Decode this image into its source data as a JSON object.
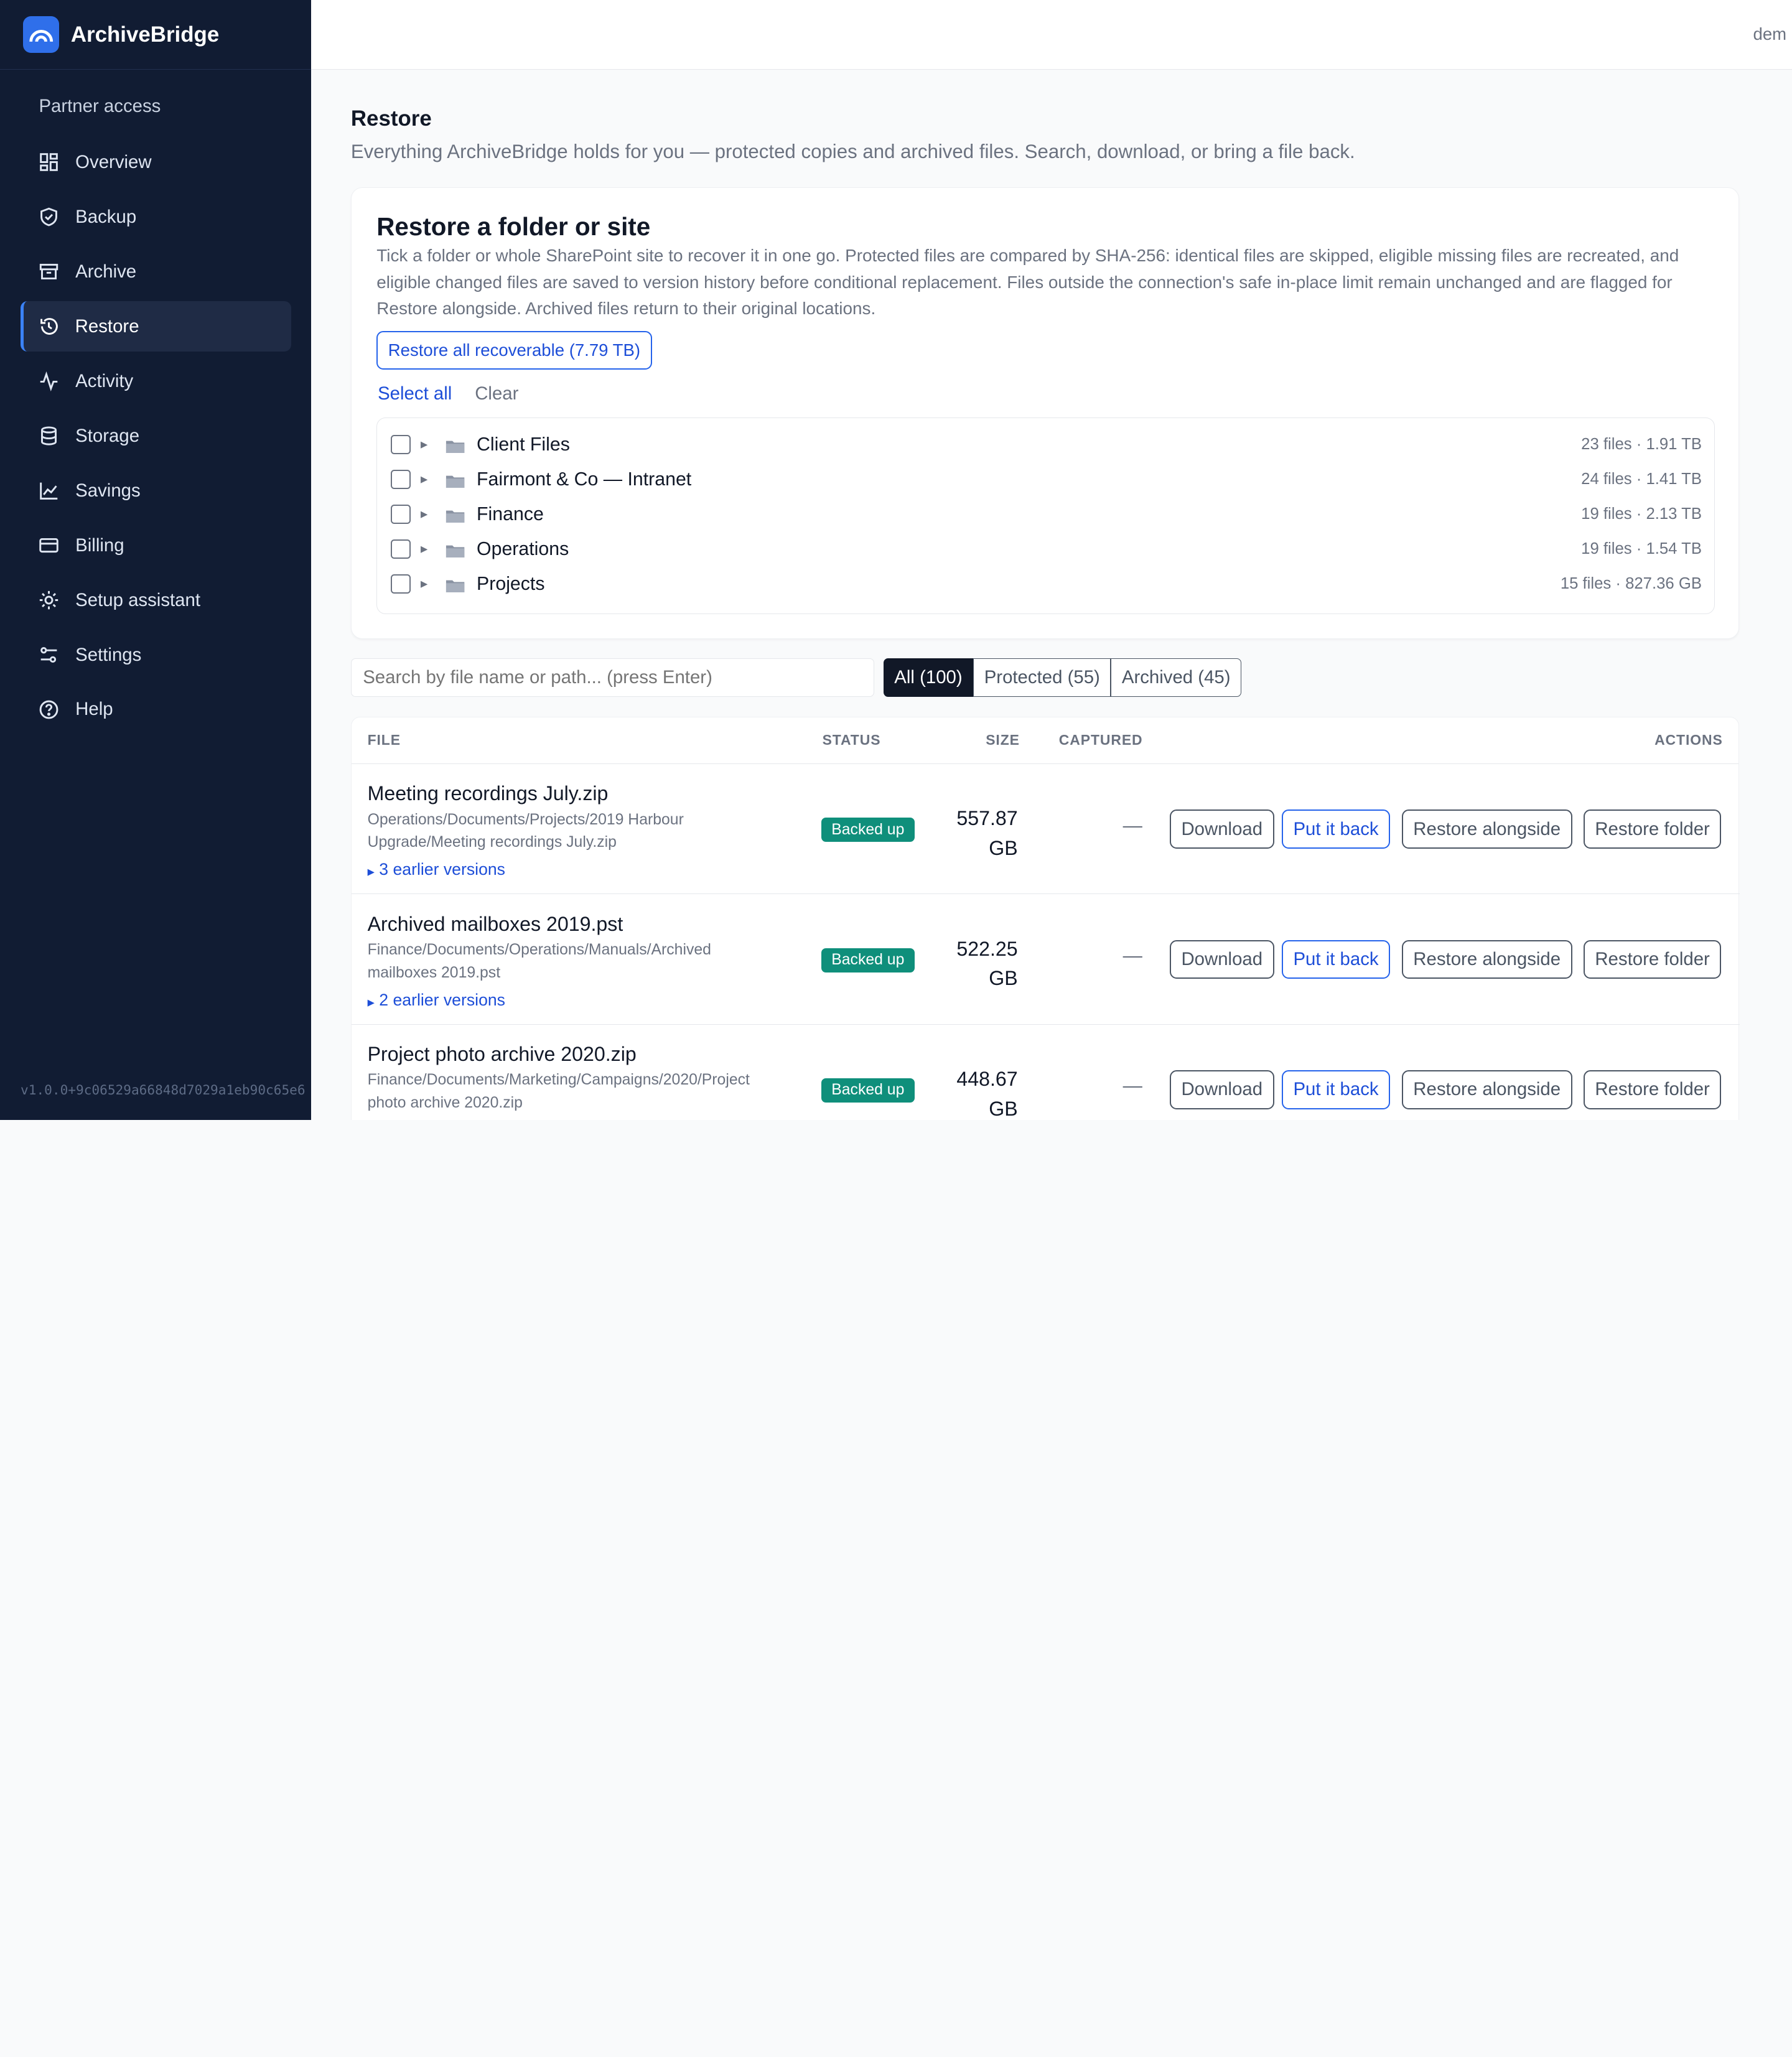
{
  "app": {
    "name": "ArchiveBridge",
    "user_label": "dem",
    "version": "v1.0.0+9c06529a66848d7029a1eb90c65e6"
  },
  "sidebar": {
    "section_label": "Partner access",
    "items": [
      {
        "label": "Overview",
        "icon": "grid-icon"
      },
      {
        "label": "Backup",
        "icon": "shield-check-icon"
      },
      {
        "label": "Archive",
        "icon": "archive-box-icon"
      },
      {
        "label": "Restore",
        "icon": "history-icon",
        "active": true
      },
      {
        "label": "Activity",
        "icon": "activity-pulse-icon"
      },
      {
        "label": "Storage",
        "icon": "database-icon"
      },
      {
        "label": "Savings",
        "icon": "line-chart-icon"
      },
      {
        "label": "Billing",
        "icon": "credit-card-icon"
      },
      {
        "label": "Setup assistant",
        "icon": "sun-gear-icon"
      },
      {
        "label": "Settings",
        "icon": "sliders-icon"
      },
      {
        "label": "Help",
        "icon": "help-circle-icon"
      }
    ]
  },
  "page": {
    "title": "Restore",
    "subtitle": "Everything ArchiveBridge holds for you — protected copies and archived files. Search, download, or bring a file back."
  },
  "restore_card": {
    "title": "Restore a folder or site",
    "description": "Tick a folder or whole SharePoint site to recover it in one go. Protected files are compared by SHA-256: identical files are skipped, eligible missing files are recreated, and eligible changed files are saved to version history before conditional replacement. Files outside the connection's safe in-place limit remain unchanged and are flagged for Restore alongside. Archived files return to their original locations.",
    "restore_all_label": "Restore all recoverable (7.79 TB)",
    "select_all_label": "Select all",
    "clear_label": "Clear",
    "folders": [
      {
        "name": "Client Files",
        "meta": "23 files · 1.91 TB"
      },
      {
        "name": "Fairmont & Co — Intranet",
        "meta": "24 files · 1.41 TB"
      },
      {
        "name": "Finance",
        "meta": "19 files · 2.13 TB"
      },
      {
        "name": "Operations",
        "meta": "19 files · 1.54 TB"
      },
      {
        "name": "Projects",
        "meta": "15 files · 827.36 GB"
      }
    ]
  },
  "search": {
    "placeholder": "Search by file name or path... (press Enter)"
  },
  "filters": [
    {
      "label": "All (100)",
      "active": true
    },
    {
      "label": "Protected (55)",
      "active": false
    },
    {
      "label": "Archived (45)",
      "active": false
    }
  ],
  "table": {
    "headers": {
      "file": "FILE",
      "status": "STATUS",
      "size": "SIZE",
      "captured": "CAPTURED",
      "actions": "ACTIONS"
    },
    "actions": {
      "download": "Download",
      "put_back": "Put it back",
      "restore_alongside": "Restore alongside",
      "restore_folder": "Restore folder"
    },
    "rows": [
      {
        "name": "Meeting recordings July.zip",
        "path": "Operations/Documents/Projects/2019 Harbour Upgrade/Meeting recordings July.zip",
        "versions": "3 earlier versions",
        "status": "Backed up",
        "size_value": "557.87",
        "size_unit": "GB",
        "captured": "—"
      },
      {
        "name": "Archived mailboxes 2019.pst",
        "path": "Finance/Documents/Operations/Manuals/Archived mailboxes 2019.pst",
        "versions": "2 earlier versions",
        "status": "Backed up",
        "size_value": "522.25",
        "size_unit": "GB",
        "captured": "—"
      },
      {
        "name": "Project photo archive 2020.zip",
        "path": "Finance/Documents/Marketing/Campaigns/2020/Project photo archive 2020.zip",
        "versions": "",
        "status": "Backed up",
        "size_value": "448.67",
        "size_unit": "GB",
        "captured": "—"
      }
    ]
  },
  "colors": {
    "sidebar_bg": "#111c33",
    "accent": "#2563eb",
    "badge_green": "#0f8f7b"
  }
}
